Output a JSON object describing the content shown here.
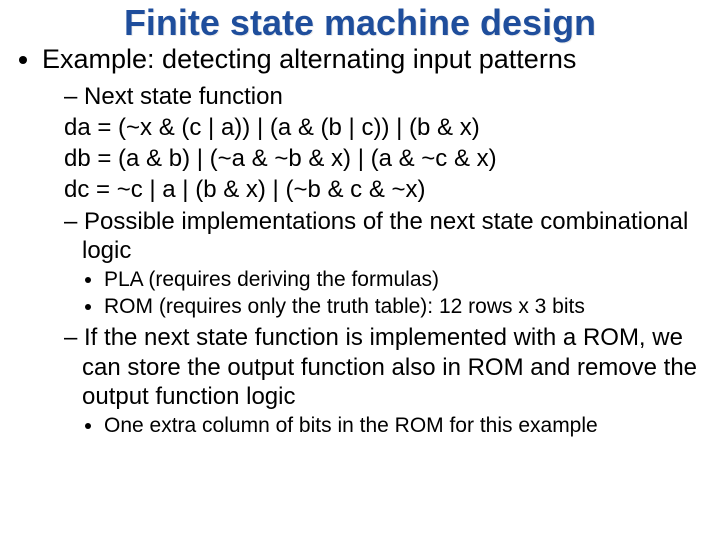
{
  "title": "Finite state machine design",
  "bullet1": "Example: detecting alternating input patterns",
  "sub1": "Next state function",
  "eq_da": "da = (~x & (c | a)) | (a & (b | c)) | (b & x)",
  "eq_db": "db = (a & b) | (~a & ~b & x) | (a & ~c & x)",
  "eq_dc": "dc =  ~c | a | (b & x) | (~b & c & ~x)",
  "sub2": "Possible implementations of the next state combinational logic",
  "impl_pla": "PLA (requires deriving the formulas)",
  "impl_rom": "ROM (requires only the truth table): 12 rows x 3 bits",
  "sub3": "If the next state function is implemented with a ROM, we can store the output function also in ROM and remove the output function logic",
  "note_rom": "One extra column of bits in the ROM for this example"
}
